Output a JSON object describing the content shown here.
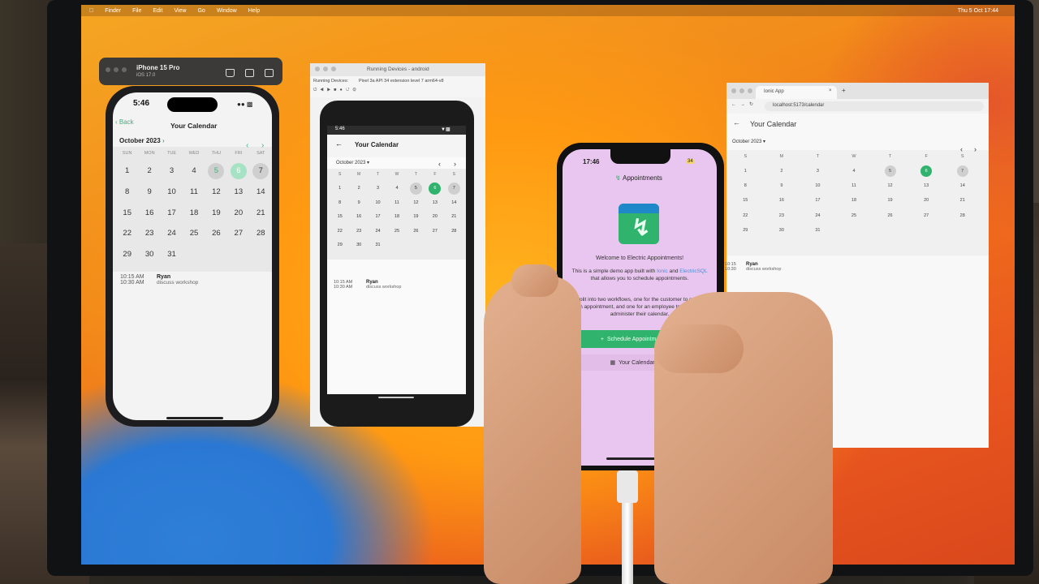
{
  "menubar": {
    "items": [
      "Finder",
      "File",
      "Edit",
      "View",
      "Go",
      "Window",
      "Help"
    ],
    "clock": "Thu 5 Oct 17:44"
  },
  "simulator": {
    "device_title": "iPhone 15 Pro",
    "device_subtitle": "iOS 17.0",
    "screen": {
      "time": "5:46",
      "back": "Back",
      "title": "Your Calendar",
      "month": "October 2023",
      "weekdays": [
        "SUN",
        "MON",
        "TUE",
        "WED",
        "THU",
        "FRI",
        "SAT"
      ],
      "days": [
        "1",
        "2",
        "3",
        "4",
        "5",
        "6",
        "7",
        "8",
        "9",
        "10",
        "11",
        "12",
        "13",
        "14",
        "15",
        "16",
        "17",
        "18",
        "19",
        "20",
        "21",
        "22",
        "23",
        "24",
        "25",
        "26",
        "27",
        "28",
        "29",
        "30",
        "31"
      ],
      "event": {
        "start": "10:15 AM",
        "end": "10:30 AM",
        "name": "Ryan",
        "desc": "discuss workshop"
      }
    }
  },
  "android": {
    "window_title": "Running Devices - android",
    "toolbar_label": "Running Devices:",
    "device_tab": "Pixel 3a API 34 extension level 7 arm64-v8",
    "screen": {
      "time": "5:46",
      "title": "Your Calendar",
      "month": "October 2023",
      "weekdays": [
        "S",
        "M",
        "T",
        "W",
        "T",
        "F",
        "S"
      ],
      "days": [
        "1",
        "2",
        "3",
        "4",
        "5",
        "6",
        "7",
        "8",
        "9",
        "10",
        "11",
        "12",
        "13",
        "14",
        "15",
        "16",
        "17",
        "18",
        "19",
        "20",
        "21",
        "22",
        "23",
        "24",
        "25",
        "26",
        "27",
        "28",
        "29",
        "30",
        "31"
      ],
      "event": {
        "start": "10:15 AM",
        "end": "10:30 AM",
        "name": "Ryan",
        "desc": "discuss workshop"
      }
    }
  },
  "browser": {
    "tab_title": "Ionic App",
    "url": "localhost:5173/calendar",
    "title": "Your Calendar",
    "month": "October 2023",
    "weekdays": [
      "S",
      "M",
      "T",
      "W",
      "T",
      "F",
      "S"
    ],
    "days": [
      "1",
      "2",
      "3",
      "4",
      "5",
      "6",
      "7",
      "8",
      "9",
      "10",
      "11",
      "12",
      "13",
      "14",
      "15",
      "16",
      "17",
      "18",
      "19",
      "20",
      "21",
      "22",
      "23",
      "24",
      "25",
      "26",
      "27",
      "28",
      "29",
      "30",
      "31"
    ],
    "event": {
      "start": "10:15",
      "end": "10:30",
      "name": "Ryan",
      "desc": "discuss workshop"
    }
  },
  "phone": {
    "time": "17:46",
    "battery": "34",
    "title": "Appointments",
    "welcome": "Welcome to Electric Appointments!",
    "para1_a": "This is a simple demo app built with",
    "para1_link1": "Ionic",
    "para1_b": "and",
    "para1_link2": "ElectricSQL",
    "para1_c": "that allows you to schedule appointments.",
    "para2": "It's split into two workflows, one for the customer to schedule an appointment, and one for an employee to view and administer their calendar.",
    "schedule_button": "Schedule Appointment",
    "calendar_button": "Your Calendar"
  },
  "colors": {
    "accent": "#2fb36d",
    "accent_light": "#a6e3c4",
    "phone_bg": "#e9c6ef"
  }
}
